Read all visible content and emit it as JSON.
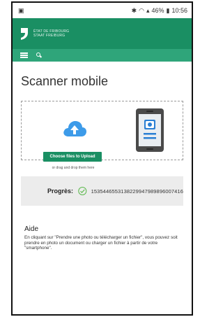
{
  "statusbar": {
    "battery_text": "46%",
    "time": "10:56",
    "icons": [
      "notification-icon",
      "bluetooth-icon",
      "wifi-icon",
      "signal-icon",
      "battery-icon"
    ]
  },
  "header": {
    "logo_line1": "ÉTAT DE FRIBOURG",
    "logo_line2": "STAAT FREIBURG",
    "brand_color": "#1a8f63"
  },
  "nav": {
    "icons": [
      "menu-icon",
      "search-icon"
    ],
    "color": "#2fa57a"
  },
  "page": {
    "title": "Scanner mobile"
  },
  "upload": {
    "button_label": "Choose files to Upload",
    "hint": "or drag and drop them here",
    "icons": [
      "cloud-upload-icon",
      "phone-scanner-icon"
    ]
  },
  "progress": {
    "label": "Progrès:",
    "id": "1535446553138229947989896007416",
    "status_icon": "check-circle-icon"
  },
  "help": {
    "title": "Aide",
    "text": "En cliquant sur \"Prendre une photo ou télécharger un fichier\", vous pouvez soit prendre en photo un document ou charger un fichier à partir de votre \"smartphone\"."
  }
}
